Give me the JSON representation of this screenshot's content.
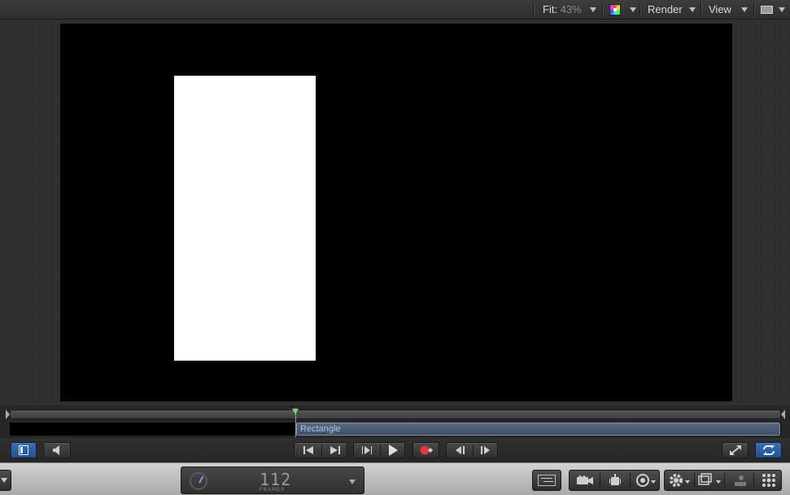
{
  "topbar": {
    "fit_label": "Fit:",
    "fit_value": "43%",
    "render_label": "Render",
    "view_label": "View"
  },
  "timeline": {
    "clip_label": "Rectangle"
  },
  "bottombar": {
    "frame_number": "112",
    "frame_unit": "FRAMES"
  },
  "icons": {
    "color_channels": "color-channels-icon",
    "layout": "window-layout-icon",
    "go_to_start": "go-to-start-icon",
    "go_to_end": "go-to-end-icon",
    "play": "play-icon",
    "record": "record-icon",
    "loop": "loop-icon"
  },
  "colors": {
    "clip_fill": "#4a5870",
    "clip_text": "#a9c2e8",
    "playhead": "#7fd07f",
    "loop_button": "#2f5ea3",
    "canvas": "#000000",
    "shape": "#ffffff"
  }
}
